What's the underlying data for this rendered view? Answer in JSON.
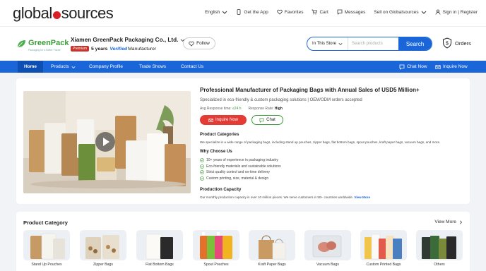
{
  "header": {
    "logo_left": "global",
    "logo_right": "sources",
    "nav": [
      {
        "label": "English",
        "icon": "chevron-down-icon"
      },
      {
        "label": "Get the App",
        "icon": "phone-icon"
      },
      {
        "label": "Favorites",
        "icon": "heart-icon"
      },
      {
        "label": "Cart",
        "icon": "cart-icon"
      },
      {
        "label": "Messages",
        "icon": "message-icon"
      },
      {
        "label": "Sell on Globalsources",
        "icon": "chevron-down-icon"
      },
      {
        "label": "Sign in | Register",
        "icon": "user-icon"
      }
    ]
  },
  "supplier": {
    "brand": "GreenPack",
    "brand_tagline": "Packaging for a Better Future",
    "company_name": "Xiamen GreenPack Packaging Co., Ltd.",
    "badge": "Premium",
    "years": "5 years",
    "verified": "Verified",
    "type": "Manufacturer",
    "follow_label": "Follow",
    "search_scope": "In This Store",
    "search_placeholder": "Search products",
    "search_button": "Search",
    "orders_label": "Orders"
  },
  "nav": {
    "home": "Home",
    "products": "Products",
    "profile": "Company Profile",
    "trade_shows": "Trade Shows",
    "contact": "Contact Us",
    "chat_now": "Chat Now",
    "inquire_now": "Inquire Now"
  },
  "main": {
    "title": "Professional Manufacturer of Packaging Bags with Annual Sales of USD5 Million+",
    "subtitle": "Specialized in eco-friendly & custom packaging solutions | OEM/ODM orders accepted",
    "response_time_label": "Avg Response time:",
    "response_time_value": "≤24 h",
    "response_rate_label": "Response Rate:",
    "response_rate_value": "High",
    "inquire_button": "Inquire Now",
    "chat_button": "Chat",
    "categories_heading": "Product Categories",
    "categories_text": "We specialize in a wide range of packaging bags, including stand up pouches, zipper bags, flat bottom bags, spout pouches, kraft paper bags, vacuum bags, and more.",
    "why_heading": "Why Choose Us",
    "why_items": [
      "10+ years of experience in packaging industry",
      "Eco-friendly materials and sustainable solutions",
      "Strict quality control and on-time delivery",
      "Custom printing, size, material & design"
    ],
    "capacity_heading": "Production Capacity",
    "capacity_text": "Our monthly production capacity is over 10 million pieces. We serve customers in 50+ countries worldwide.",
    "view_more": "View More"
  },
  "category": {
    "title": "Product Category",
    "view_more": "View More",
    "items": [
      "Stand Up Pouches",
      "Zipper Bags",
      "Flat Bottom Bags",
      "Spout Pouches",
      "Kraft Paper Bags",
      "Vacuum Bags",
      "Custom Printed Bags",
      "Others"
    ]
  },
  "colors": {
    "brand_blue": "#1a66d8",
    "brand_red": "#e43b35",
    "green": "#3c9b3a"
  }
}
